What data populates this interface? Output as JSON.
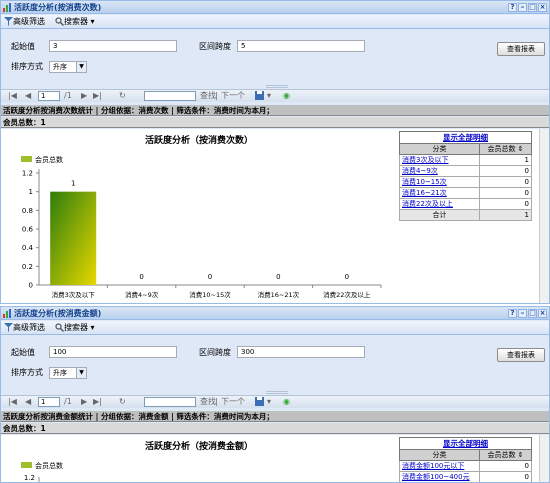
{
  "win1": {
    "title": "活跃度分析(按消费次数)",
    "title_buttons": [
      "?",
      "–",
      "□",
      "×"
    ],
    "toolbar": {
      "advanced": "高级筛选",
      "search": "搜索器"
    },
    "form": {
      "start_label": "起始值",
      "start_value": "3",
      "interval_label": "区间跨度",
      "interval_value": "5",
      "sort_label": "排序方式",
      "sort_value": "升序",
      "view_button": "查看报表"
    },
    "pager": {
      "page_input": "1",
      "page_total": "/1",
      "search_label": "查找",
      "next_label": "下一个"
    },
    "report_title": "活跃度分析按消费次数统计 | 分组依据：消费次数 | 筛选条件：消费时间为本月；",
    "member_total": "会员总数：1",
    "chart_data": {
      "type": "bar",
      "title": "活跃度分析（按消费次数）",
      "legend": "会员总数",
      "categories": [
        "消费3次及以下",
        "消费4~9次",
        "消费10~15次",
        "消费16~21次",
        "消费22次及以上"
      ],
      "values": [
        1,
        0,
        0,
        0,
        0
      ],
      "ylim": [
        0,
        1.2
      ],
      "yticks": [
        "0",
        "0.2",
        "0.4",
        "0.6",
        "0.8",
        "1",
        "1.2"
      ]
    },
    "side": {
      "link": "显示全部明细",
      "headers": [
        "分类",
        "会员总数"
      ],
      "rows": [
        {
          "name": "消费3次及以下",
          "value": "1"
        },
        {
          "name": "消费4~9次",
          "value": "0"
        },
        {
          "name": "消费10~15次",
          "value": "0"
        },
        {
          "name": "消费16~21次",
          "value": "0"
        },
        {
          "name": "消费22次及以上",
          "value": "0"
        }
      ],
      "total_label": "合计",
      "total_value": "1"
    }
  },
  "win2": {
    "title": "活跃度分析(按消费金额)",
    "title_buttons": [
      "?",
      "–",
      "□",
      "×"
    ],
    "toolbar": {
      "advanced": "高级筛选",
      "search": "搜索器"
    },
    "form": {
      "start_label": "起始值",
      "start_value": "100",
      "interval_label": "区间跨度",
      "interval_value": "300",
      "sort_label": "排序方式",
      "sort_value": "升序",
      "view_button": "查看报表"
    },
    "pager": {
      "page_input": "1",
      "page_total": "/1",
      "search_label": "查找",
      "next_label": "下一个"
    },
    "report_title": "活跃度分析按消费金额统计 | 分组依据：消费金额 | 筛选条件：消费时间为本月；",
    "member_total": "会员总数：1",
    "chart_title": "活跃度分析（按消费金额）",
    "legend": "会员总数",
    "ytop": "1.2",
    "side": {
      "link": "显示全部明细",
      "headers": [
        "分类",
        "会员总数"
      ],
      "rows": [
        {
          "name": "消费金额100元以下",
          "value": "0"
        },
        {
          "name": "消费金额100~400元",
          "value": "0"
        }
      ]
    }
  },
  "colors": {
    "bar_top": "#2e7d0c",
    "bar_bottom": "#e8d800",
    "header_blue": "#15428b",
    "link": "#0000cc"
  }
}
